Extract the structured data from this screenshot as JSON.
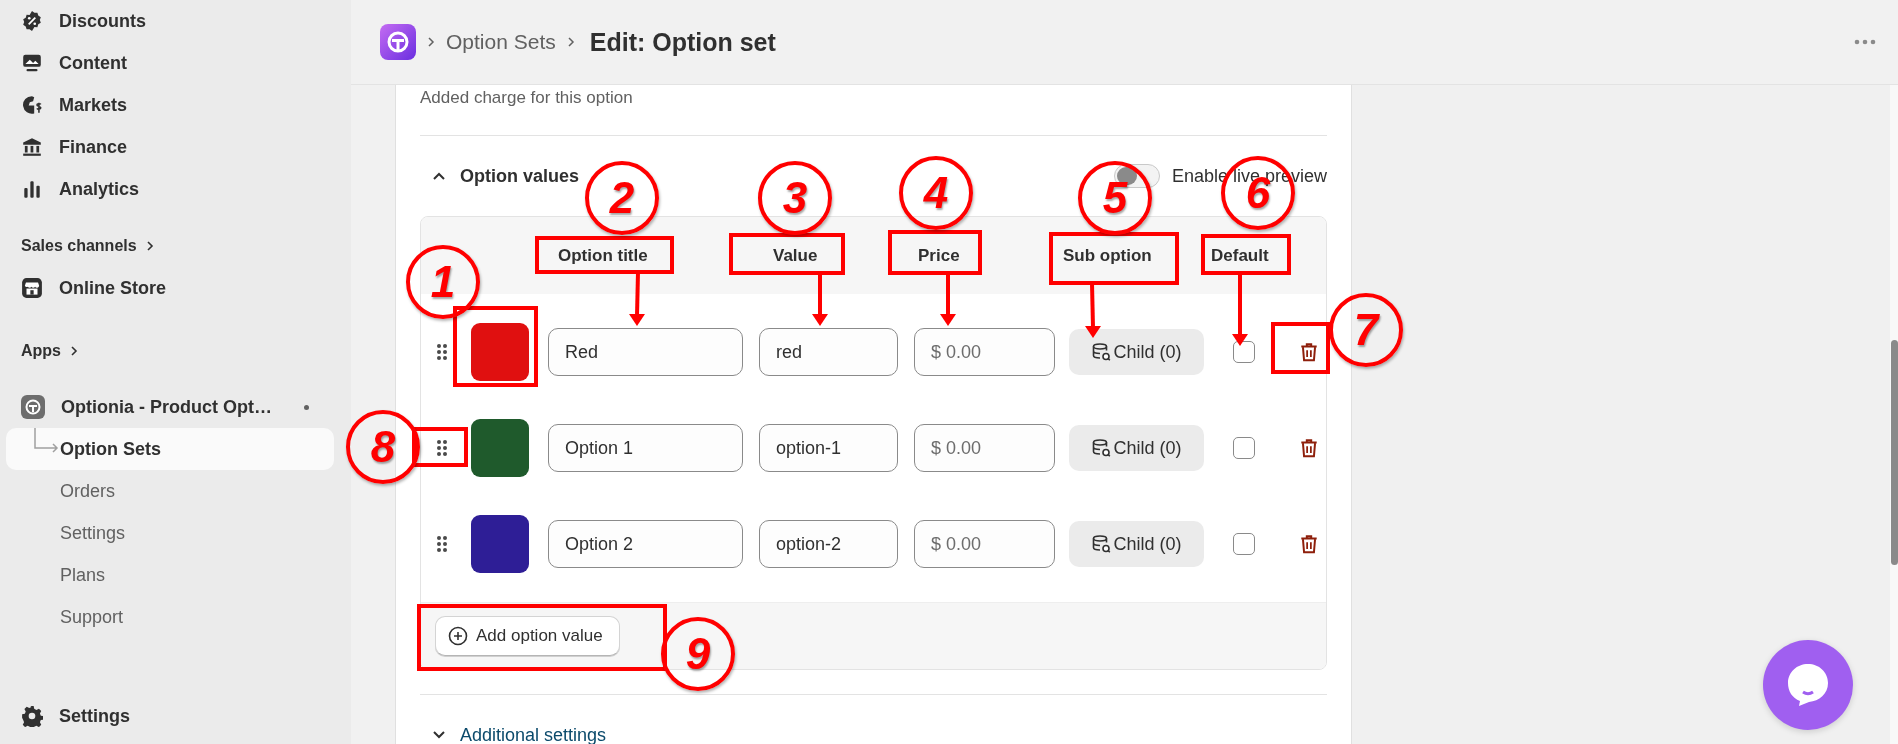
{
  "sidebar": {
    "items": [
      {
        "kind": "nav",
        "label": "Discounts"
      },
      {
        "kind": "nav",
        "label": "Content"
      },
      {
        "kind": "nav",
        "label": "Markets"
      },
      {
        "kind": "nav",
        "label": "Finance"
      },
      {
        "kind": "nav",
        "label": "Analytics"
      },
      {
        "kind": "section",
        "label": "Sales channels"
      },
      {
        "kind": "nav",
        "label": "Online Store"
      },
      {
        "kind": "section",
        "label": "Apps"
      },
      {
        "kind": "app",
        "label": "Optionia - Product Opt…",
        "children": [
          {
            "label": "Option Sets",
            "selected": true
          },
          {
            "label": "Orders",
            "selected": false
          },
          {
            "label": "Settings",
            "selected": false
          },
          {
            "label": "Plans",
            "selected": false
          },
          {
            "label": "Support",
            "selected": false
          }
        ]
      }
    ],
    "footer": {
      "label": "Settings"
    }
  },
  "header": {
    "breadcrumb": [
      "Option Sets"
    ],
    "title": "Edit: Option set"
  },
  "card": {
    "help_text": "Added charge for this option",
    "section": {
      "title": "Option values",
      "expanded": true
    },
    "live_preview": {
      "label": "Enable live preview",
      "on": false
    },
    "table": {
      "columns": [
        "Option title",
        "Value",
        "Price",
        "Sub option",
        "Default"
      ],
      "rows": [
        {
          "color": "#e01010",
          "title": "Red",
          "value": "red",
          "price_placeholder": "$ 0.00",
          "sub_option": "Child (0)",
          "default": false
        },
        {
          "color": "#1f5a2c",
          "title": "Option 1",
          "value": "option-1",
          "price_placeholder": "$ 0.00",
          "sub_option": "Child (0)",
          "default": false
        },
        {
          "color": "#2e1e96",
          "title": "Option 2",
          "value": "option-2",
          "price_placeholder": "$ 0.00",
          "sub_option": "Child (0)",
          "default": false
        }
      ]
    },
    "add_button": "Add option value",
    "additional": {
      "title": "Additional settings",
      "expanded": false
    }
  },
  "callouts": [
    {
      "label": "1"
    },
    {
      "label": "2"
    },
    {
      "label": "3"
    },
    {
      "label": "4"
    },
    {
      "label": "5"
    },
    {
      "label": "6"
    },
    {
      "label": "7"
    },
    {
      "label": "8"
    },
    {
      "label": "9"
    }
  ]
}
